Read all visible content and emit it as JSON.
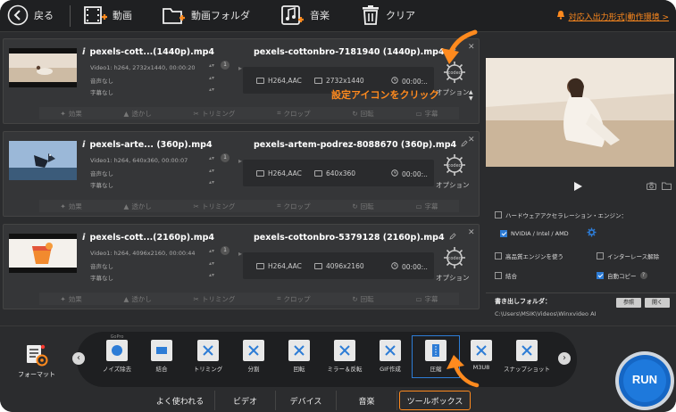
{
  "toolbar": {
    "back_label": "戻る",
    "add_video_label": "動画",
    "add_folder_label": "動画フォルダ",
    "music_label": "音楽",
    "clear_label": "クリア",
    "support_link": "対応入出力形式|動作環境 >"
  },
  "files": [
    {
      "src_name": "pexels-cott...(1440p).mp4",
      "video_meta": "Video1: h264, 2732x1440, 00:00:20",
      "audio_meta": "音声なし",
      "subtitle_meta": "字幕なし",
      "track_badge": "1",
      "out_name": "pexels-cottonbro-7181940 (1440p).mp4",
      "codec": "H264,AAC",
      "resolution": "2732x1440",
      "duration": "00:00:..",
      "option_label": "オプション"
    },
    {
      "src_name": "pexels-arte... (360p).mp4",
      "video_meta": "Video1: h264, 640x360, 00:00:07",
      "audio_meta": "音声なし",
      "subtitle_meta": "字幕なし",
      "track_badge": "1",
      "out_name": "pexels-artem-podrez-8088670 (360p).mp4",
      "codec": "H264,AAC",
      "resolution": "640x360",
      "duration": "00:00:..",
      "option_label": "オプション"
    },
    {
      "src_name": "pexels-cott...(2160p).mp4",
      "video_meta": "Video1: h264, 4096x2160, 00:00:44",
      "audio_meta": "音声なし",
      "subtitle_meta": "字幕なし",
      "track_badge": "1",
      "out_name": "pexels-cottonbro-5379128 (2160p).mp4",
      "codec": "H264,AAC",
      "resolution": "4096x2160",
      "duration": "00:00:..",
      "option_label": "オプション"
    }
  ],
  "edit_bar": [
    "効果",
    "透かし",
    "トリミング",
    "クロップ",
    "回転",
    "字幕"
  ],
  "callout": "設定アイコンをクリック",
  "settings": {
    "hw_accel_label": "ハードウェアアクセラレーション・エンジン：",
    "hw_vendor_label": "NVIDIA / Intel / AMD",
    "hq_engine_label": "高品質エンジンを使う",
    "deinterlace_label": "インターレース解除",
    "merge_label": "結合",
    "auto_copy_label": "自動コピー"
  },
  "output": {
    "label": "書き出しフォルダ：",
    "path": "C:\\Users\\MSIK\\Videos\\Winxvideo AI",
    "browse_label": "参照",
    "open_label": "開く"
  },
  "format_label": "フォーマット",
  "tools": [
    {
      "label": "ノイズ除去",
      "badge": "GoPro"
    },
    {
      "label": "結合"
    },
    {
      "label": "トリミング"
    },
    {
      "label": "分割"
    },
    {
      "label": "回転"
    },
    {
      "label": "ミラー＆反転"
    },
    {
      "label": "GIF作成"
    },
    {
      "label": "圧縮"
    },
    {
      "label": "M3U8"
    },
    {
      "label": "スナップショット"
    }
  ],
  "tabs": [
    "よく使われる",
    "ビデオ",
    "デバイス",
    "音楽",
    "ツールボックス"
  ],
  "run_label": "RUN",
  "accent_color": "#ff8a1e",
  "highlight_color": "#2d7cd6"
}
